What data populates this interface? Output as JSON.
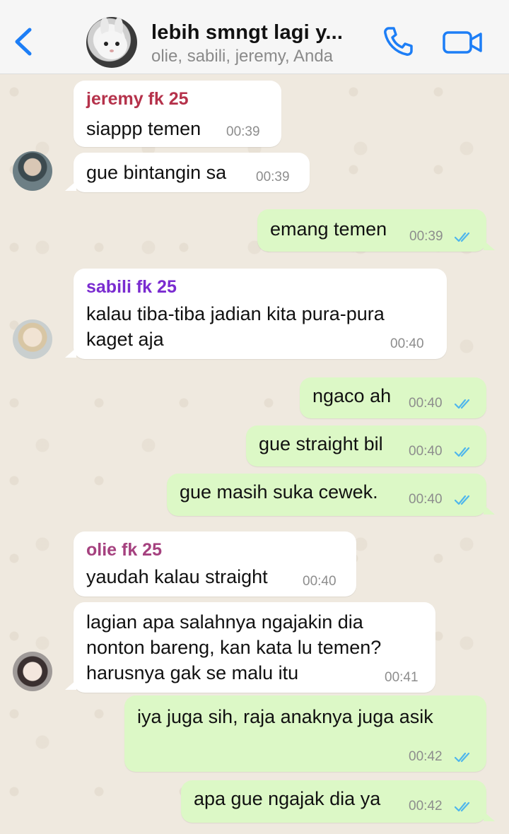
{
  "header": {
    "title": "lebih smngt lagi y...",
    "subtitle": "olie, sabili, jeremy, Anda"
  },
  "messages": [
    {
      "type": "in",
      "sender": "jeremy fk 25",
      "sender_color": "#b5324b",
      "lines": [
        "siappp temen"
      ],
      "time": "00:39"
    },
    {
      "type": "in",
      "lines": [
        "gue bintangin sa"
      ],
      "time": "00:39"
    },
    {
      "type": "out",
      "lines": [
        "emang temen"
      ],
      "time": "00:39",
      "status": "read"
    },
    {
      "type": "in",
      "sender": "sabili fk 25",
      "sender_color": "#7a2bd0",
      "lines": [
        "kalau tiba-tiba jadian kita pura-pura",
        "kaget aja"
      ],
      "time": "00:40"
    },
    {
      "type": "out",
      "lines": [
        "ngaco ah"
      ],
      "time": "00:40",
      "status": "read"
    },
    {
      "type": "out",
      "lines": [
        "gue straight bil"
      ],
      "time": "00:40",
      "status": "read"
    },
    {
      "type": "out",
      "lines": [
        "gue masih suka cewek."
      ],
      "time": "00:40",
      "status": "read"
    },
    {
      "type": "in",
      "sender": "olie fk 25",
      "sender_color": "#a5417f",
      "lines": [
        "yaudah kalau straight"
      ],
      "time": "00:40"
    },
    {
      "type": "in",
      "lines": [
        "lagian apa salahnya ngajakin dia",
        "nonton bareng, kan kata lu temen?",
        "harusnya gak se malu itu"
      ],
      "time": "00:41"
    },
    {
      "type": "out",
      "lines": [
        "iya juga sih, raja anaknya juga asik"
      ],
      "time": "00:42",
      "status": "read"
    },
    {
      "type": "out",
      "lines": [
        "apa gue ngajak dia ya"
      ],
      "time": "00:42",
      "status": "read"
    }
  ],
  "colors": {
    "tick_read": "#4fb6ec",
    "outgoing_bubble": "#dcf8c6",
    "incoming_bubble": "#ffffff",
    "header_icons": "#1d7ef6"
  }
}
